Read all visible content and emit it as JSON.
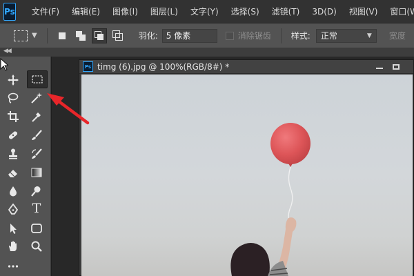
{
  "app": {
    "logo_text": "Ps",
    "menu": [
      "文件(F)",
      "编辑(E)",
      "图像(I)",
      "图层(L)",
      "文字(Y)",
      "选择(S)",
      "滤镜(T)",
      "3D(D)",
      "视图(V)",
      "窗口(W)"
    ]
  },
  "options_bar": {
    "feather_label": "羽化:",
    "feather_value": "5 像素",
    "antialias_label": "消除锯齿",
    "style_label": "样式:",
    "style_value": "正常",
    "width_label": "宽度"
  },
  "document": {
    "icon_text": "Ps",
    "title": "timg (6).jpg @ 100%(RGB/8#) *"
  },
  "tools": {
    "type_tool_glyph": "T"
  },
  "colors": {
    "menubar_bg": "#323232",
    "panel_bg": "#535353",
    "accent_blue": "#31a8ff",
    "annotation_red": "#e8262a",
    "balloon_red": "#e0565a"
  }
}
